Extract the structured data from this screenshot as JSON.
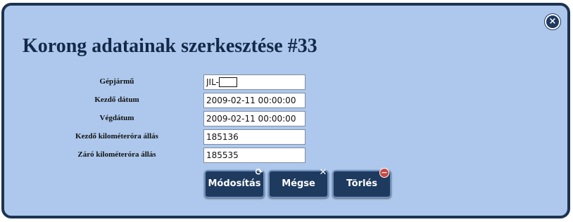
{
  "dialog": {
    "title": "Korong adatainak szerkesztése #33",
    "close_label": "×"
  },
  "form": {
    "fields": [
      {
        "label": "Gépjármű",
        "value": "JIL-"
      },
      {
        "label": "Kezdő dátum",
        "value": "2009-02-11 00:00:00"
      },
      {
        "label": "Végdátum",
        "value": "2009-02-11 00:00:00"
      },
      {
        "label": "Kezdő kilométeróra állás",
        "value": "185136"
      },
      {
        "label": "Záró kilométeróra állás",
        "value": "185535"
      }
    ]
  },
  "buttons": {
    "modify": {
      "label": "Módosítás",
      "icon": "refresh-icon",
      "glyph": "⟳"
    },
    "cancel": {
      "label": "Mégse",
      "icon": "close-x-icon",
      "glyph": "✕"
    },
    "delete": {
      "label": "Törlés",
      "icon": "remove-icon",
      "glyph": "−"
    }
  },
  "colors": {
    "dialog_bg": "#adc8ec",
    "border": "#1c3352",
    "button_bg": "#1e3a5f",
    "title": "#13294a"
  }
}
